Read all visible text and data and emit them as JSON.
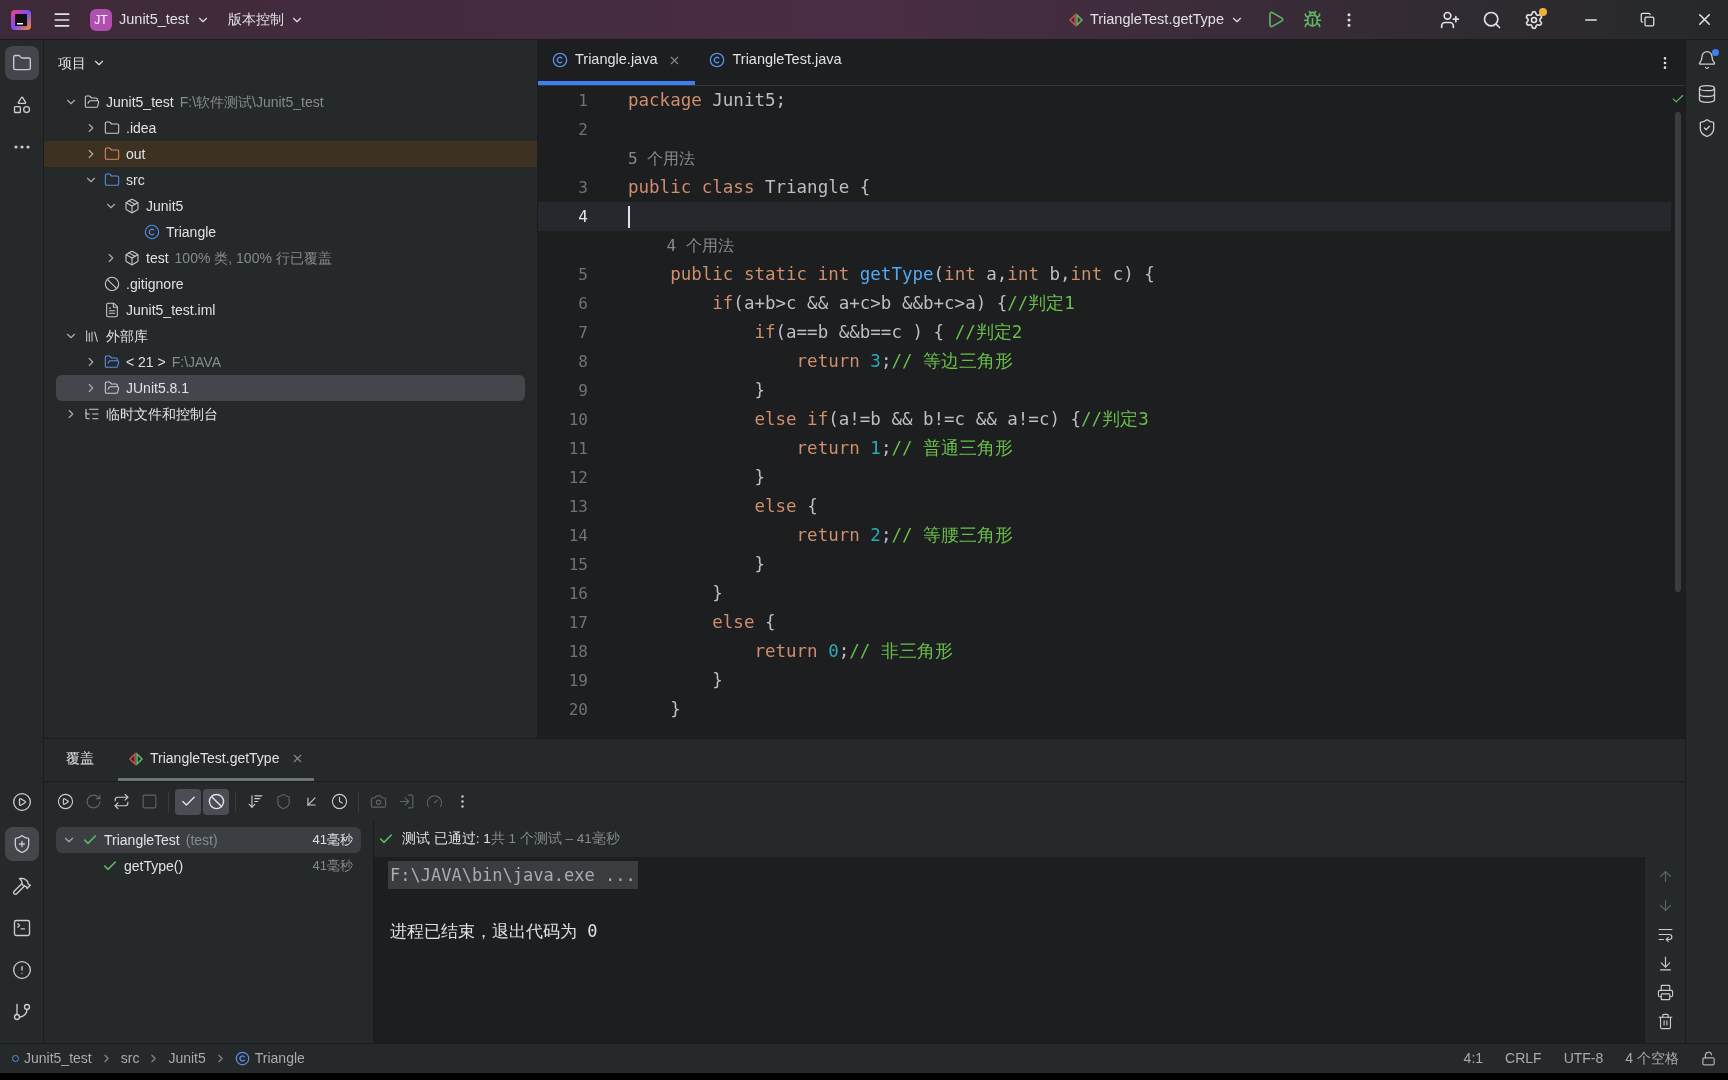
{
  "title_bar": {
    "project_badge": "JT",
    "project": "Junit5_test",
    "vcs": "版本控制",
    "run_config": "TriangleTest.getType",
    "settings_notification": true
  },
  "left_strip": {
    "top": [
      {
        "kind": "project",
        "selected": true
      },
      {
        "kind": "structure",
        "selected": false
      },
      {
        "kind": "more",
        "selected": false
      }
    ],
    "bottom": [
      {
        "kind": "run",
        "selected": false
      },
      {
        "kind": "coverage",
        "selected": true
      },
      {
        "kind": "build",
        "selected": false
      },
      {
        "kind": "terminal",
        "selected": false
      },
      {
        "kind": "problems",
        "selected": false
      },
      {
        "kind": "git",
        "selected": false
      }
    ]
  },
  "project_panel": {
    "title": "项目",
    "tree": [
      {
        "name": "Junit5_test",
        "hint": "F:\\软件测试\\Junit5_test",
        "kind": "module",
        "expanded": true,
        "selected": false,
        "children": [
          {
            "name": ".idea",
            "kind": "folder",
            "expanded": false,
            "selected": false
          },
          {
            "name": "out",
            "kind": "excluded-folder",
            "expanded": false,
            "selected": false
          },
          {
            "name": "src",
            "kind": "source-folder",
            "expanded": true,
            "selected": false,
            "children": [
              {
                "name": "Junit5",
                "kind": "package",
                "expanded": true,
                "selected": false,
                "children": [
                  {
                    "name": "Triangle",
                    "kind": "class",
                    "selected": false
                  }
                ]
              },
              {
                "name": "test",
                "hint": "100% 类, 100% 行已覆盖",
                "kind": "package",
                "expanded": false,
                "selected": false
              }
            ]
          },
          {
            "name": ".gitignore",
            "kind": "ignore",
            "selected": false
          },
          {
            "name": "Junit5_test.iml",
            "kind": "file",
            "selected": false
          }
        ]
      },
      {
        "name": "外部库",
        "kind": "libraries",
        "expanded": true,
        "selected": false,
        "children": [
          {
            "name": "< 21 >",
            "hint": "F:\\JAVA",
            "kind": "sdk",
            "expanded": false,
            "selected": false
          },
          {
            "name": "JUnit5.8.1",
            "kind": "jar",
            "expanded": false,
            "selected": true
          }
        ]
      },
      {
        "name": "临时文件和控制台",
        "kind": "scratch",
        "expanded": false,
        "selected": false
      }
    ]
  },
  "editor": {
    "tabs": [
      {
        "label": "Triangle.java",
        "selected": true
      },
      {
        "label": "TriangleTest.java",
        "selected": false
      }
    ],
    "lines": [
      {
        "kind": "code",
        "number": "1",
        "current": false,
        "tokens": [
          {
            "kind": "kw",
            "text": "package "
          },
          {
            "kind": "plain",
            "text": "Junit5;"
          }
        ]
      },
      {
        "kind": "code",
        "number": "2",
        "current": false
      },
      {
        "kind": "hint",
        "text": "5 个用法"
      },
      {
        "kind": "code",
        "number": "3",
        "current": false,
        "tokens": [
          {
            "kind": "kw",
            "text": "public class "
          },
          {
            "kind": "plain",
            "text": "Triangle {"
          }
        ]
      },
      {
        "kind": "code",
        "number": "4",
        "current": true
      },
      {
        "kind": "hint",
        "text": "    4 个用法"
      },
      {
        "kind": "code",
        "number": "5",
        "current": false,
        "tokens": [
          {
            "kind": "kw",
            "text": "    public static int "
          },
          {
            "kind": "fn",
            "text": "getType"
          },
          {
            "kind": "plain",
            "text": "("
          },
          {
            "kind": "kw",
            "text": "int "
          },
          {
            "kind": "plain",
            "text": "a,"
          },
          {
            "kind": "kw",
            "text": "int "
          },
          {
            "kind": "plain",
            "text": "b,"
          },
          {
            "kind": "kw",
            "text": "int "
          },
          {
            "kind": "plain",
            "text": "c) {"
          }
        ]
      },
      {
        "kind": "code",
        "number": "6",
        "current": false,
        "tokens": [
          {
            "kind": "kw",
            "text": "        if"
          },
          {
            "kind": "plain",
            "text": "(a+b>c && a+c>b &&b+c>a) {"
          },
          {
            "kind": "cm",
            "text": "//判定1"
          }
        ]
      },
      {
        "kind": "code",
        "number": "7",
        "current": false,
        "tokens": [
          {
            "kind": "kw",
            "text": "            if"
          },
          {
            "kind": "plain",
            "text": "(a==b &&b==c ) { "
          },
          {
            "kind": "cm",
            "text": "//判定2"
          }
        ]
      },
      {
        "kind": "code",
        "number": "8",
        "current": false,
        "tokens": [
          {
            "kind": "kw",
            "text": "                return "
          },
          {
            "kind": "num",
            "text": "3"
          },
          {
            "kind": "plain",
            "text": ";"
          },
          {
            "kind": "cm",
            "text": "// 等边三角形"
          }
        ]
      },
      {
        "kind": "code",
        "number": "9",
        "current": false,
        "tokens": [
          {
            "kind": "plain",
            "text": "            }"
          }
        ]
      },
      {
        "kind": "code",
        "number": "10",
        "current": false,
        "tokens": [
          {
            "kind": "kw",
            "text": "            else if"
          },
          {
            "kind": "plain",
            "text": "(a!=b && b!=c && a!=c) {"
          },
          {
            "kind": "cm",
            "text": "//判定3"
          }
        ]
      },
      {
        "kind": "code",
        "number": "11",
        "current": false,
        "tokens": [
          {
            "kind": "kw",
            "text": "                return "
          },
          {
            "kind": "num",
            "text": "1"
          },
          {
            "kind": "plain",
            "text": ";"
          },
          {
            "kind": "cm",
            "text": "// 普通三角形"
          }
        ]
      },
      {
        "kind": "code",
        "number": "12",
        "current": false,
        "tokens": [
          {
            "kind": "plain",
            "text": "            }"
          }
        ]
      },
      {
        "kind": "code",
        "number": "13",
        "current": false,
        "tokens": [
          {
            "kind": "kw",
            "text": "            else "
          },
          {
            "kind": "plain",
            "text": "{"
          }
        ]
      },
      {
        "kind": "code",
        "number": "14",
        "current": false,
        "tokens": [
          {
            "kind": "kw",
            "text": "                return "
          },
          {
            "kind": "num",
            "text": "2"
          },
          {
            "kind": "plain",
            "text": ";"
          },
          {
            "kind": "cm",
            "text": "// 等腰三角形"
          }
        ]
      },
      {
        "kind": "code",
        "number": "15",
        "current": false,
        "tokens": [
          {
            "kind": "plain",
            "text": "            }"
          }
        ]
      },
      {
        "kind": "code",
        "number": "16",
        "current": false,
        "tokens": [
          {
            "kind": "plain",
            "text": "        }"
          }
        ]
      },
      {
        "kind": "code",
        "number": "17",
        "current": false,
        "tokens": [
          {
            "kind": "kw",
            "text": "        else "
          },
          {
            "kind": "plain",
            "text": "{"
          }
        ]
      },
      {
        "kind": "code",
        "number": "18",
        "current": false,
        "tokens": [
          {
            "kind": "kw",
            "text": "            return "
          },
          {
            "kind": "num",
            "text": "0"
          },
          {
            "kind": "plain",
            "text": ";"
          },
          {
            "kind": "cm",
            "text": "// 非三角形"
          }
        ]
      },
      {
        "kind": "code",
        "number": "19",
        "current": false,
        "tokens": [
          {
            "kind": "plain",
            "text": "        }"
          }
        ]
      },
      {
        "kind": "code",
        "number": "20",
        "current": false,
        "tokens": [
          {
            "kind": "plain",
            "text": "    }"
          }
        ]
      }
    ]
  },
  "right_strip": [
    {
      "kind": "notifications",
      "badge": true
    },
    {
      "kind": "database",
      "badge": false
    },
    {
      "kind": "shield",
      "badge": false
    }
  ],
  "bottom_panel": {
    "tabs": [
      {
        "label": "覆盖",
        "kind": "plain",
        "selected": false
      },
      {
        "label": "TriangleTest.getType",
        "kind": "run",
        "selected": true
      }
    ],
    "filters": [
      {
        "kind": "passed",
        "on": true
      },
      {
        "kind": "ignored",
        "on": true
      }
    ],
    "tests": [
      {
        "name": "TriangleTest",
        "hint": "(test)",
        "time": "41毫秒",
        "passed": true,
        "expanded": true,
        "selected": true,
        "children": [
          {
            "name": "getType()",
            "time": "41毫秒",
            "passed": true,
            "selected": false
          }
        ]
      }
    ],
    "status": {
      "passed": "测试 已通过: 1",
      "summary": "共 1 个测试 – 41毫秒"
    },
    "console": [
      {
        "text": "F:\\JAVA\\bin\\java.exe ...",
        "highlighted": true
      },
      {
        "text": "进程已结束，退出代码为 0",
        "highlighted": false
      }
    ]
  },
  "status_bar": {
    "breadcrumbs": [
      {
        "text": "Junit5_test",
        "kind": "module"
      },
      {
        "text": "src",
        "kind": "plain"
      },
      {
        "text": "Junit5",
        "kind": "plain"
      },
      {
        "text": "Triangle",
        "kind": "class"
      }
    ],
    "items": [
      "4:1",
      "CRLF",
      "UTF-8",
      "4 个空格"
    ]
  }
}
